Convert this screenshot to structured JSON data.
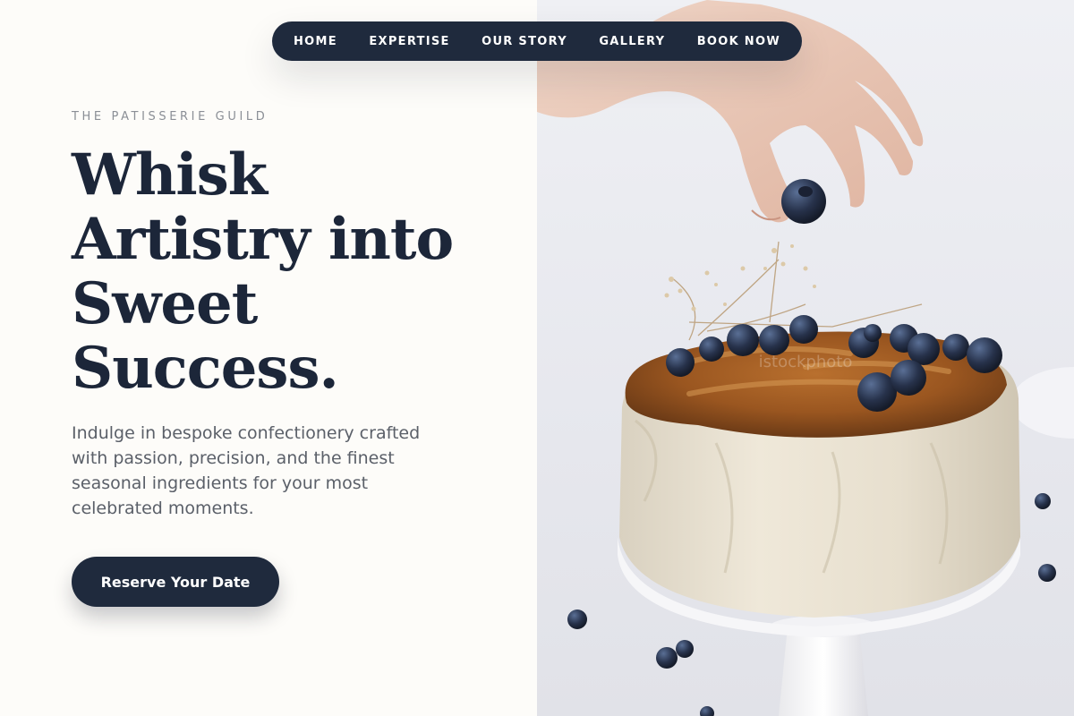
{
  "nav": {
    "items": [
      {
        "label": "HOME"
      },
      {
        "label": "EXPERTISE"
      },
      {
        "label": "OUR STORY"
      },
      {
        "label": "GALLERY"
      },
      {
        "label": "BOOK NOW"
      }
    ]
  },
  "hero": {
    "eyebrow": "THE PATISSERIE GUILD",
    "headline_lines": [
      "Whisk",
      "Artistry into",
      "Sweet",
      "Success."
    ],
    "description": "Indulge in bespoke confectionery crafted with passion, precision, and the finest seasonal ingredients for your most celebrated moments.",
    "cta_label": "Reserve Your Date"
  },
  "photo": {
    "subject": "hand-placing-blueberry-on-frosted-cake"
  },
  "colors": {
    "navy": "#1f2a3d",
    "page_background": "#fdfcf9",
    "eyebrow_gray": "#8b8f96",
    "body_gray": "#5b6069"
  }
}
